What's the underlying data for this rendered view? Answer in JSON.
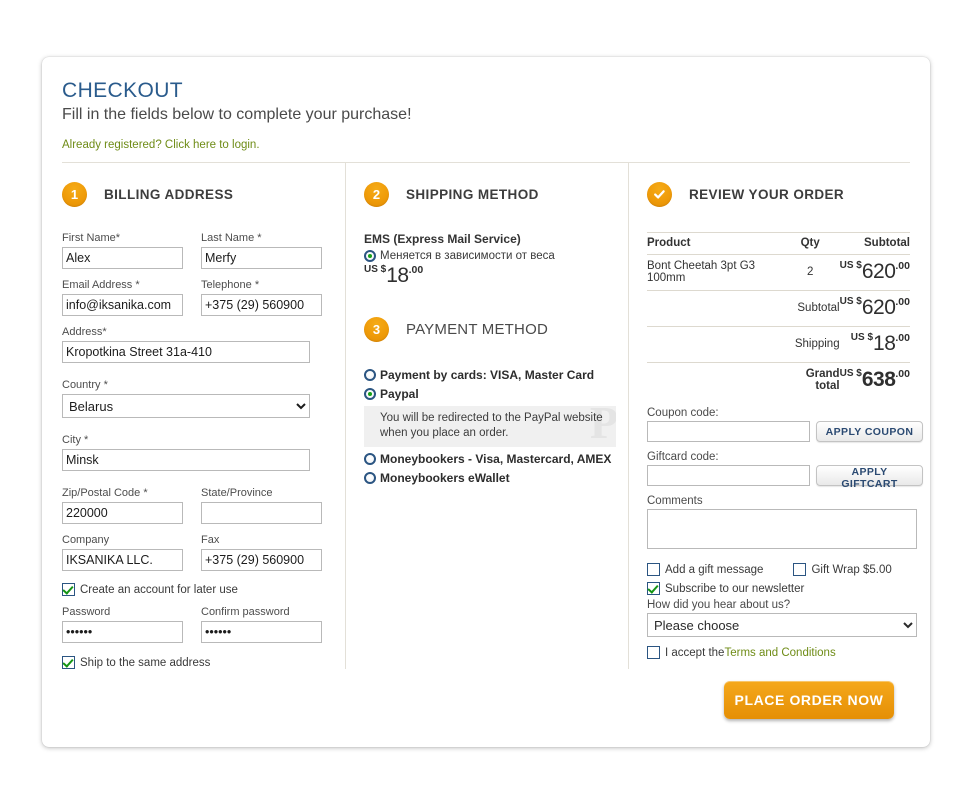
{
  "header": {
    "title": "CHECKOUT",
    "subtitle": "Fill in the fields below to complete your purchase!",
    "login_link": "Already registered? Click here to login."
  },
  "colors": {
    "accent_orange": "#ef9b09",
    "title_blue": "#2a5b8c",
    "link_green": "#6f8c17",
    "button_blue_text": "#2b4a72"
  },
  "billing": {
    "step_number": "1",
    "step_title": "BILLING ADDRESS",
    "fields": {
      "first_name_label": "First Name*",
      "first_name_value": "Alex",
      "last_name_label": "Last Name *",
      "last_name_value": "Merfy",
      "email_label": "Email Address *",
      "email_value": "info@iksanika.com",
      "telephone_label": "Telephone *",
      "telephone_value": "+375 (29) 560900",
      "address_label": "Address*",
      "address_value": "Kropotkina Street 31a-410",
      "country_label": "Country *",
      "country_value": "Belarus",
      "city_label": "City *",
      "city_value": "Minsk",
      "zip_label": "Zip/Postal Code *",
      "zip_value": "220000",
      "state_label": "State/Province",
      "state_value": "",
      "company_label": "Company",
      "company_value": "IKSANIKA LLC.",
      "fax_label": "Fax",
      "fax_value": "+375 (29) 560900",
      "password_label": "Password",
      "password_value": "······",
      "confirm_password_label": "Confirm password",
      "confirm_password_value": "······"
    },
    "create_account_label": "Create an account for later use",
    "create_account_checked": true,
    "ship_same_label": "Ship to the same address",
    "ship_same_checked": true
  },
  "shipping": {
    "step_number": "2",
    "step_title": "SHIPPING METHOD",
    "carrier": "EMS (Express Mail Service)",
    "option_label": "Меняется в зависимости от веса",
    "option_selected": true,
    "price_currency": "US $",
    "price_int": "18",
    "price_dec": ".00"
  },
  "payment": {
    "step_number": "3",
    "step_title": "PAYMENT METHOD",
    "options": [
      {
        "label": "Payment by cards: VISA, Master Card",
        "selected": false
      },
      {
        "label": "Paypal",
        "selected": true
      },
      {
        "label": "Moneybookers - Visa, Mastercard, AMEX",
        "selected": false
      },
      {
        "label": "Moneybookers eWallet",
        "selected": false
      }
    ],
    "paypal_note": "You will be redirected to the PayPal website when you place an order.",
    "paypal_watermark": "P"
  },
  "review": {
    "step_title": "REVIEW YOUR ORDER",
    "badge_icon": "check-icon",
    "table": {
      "headers": {
        "product": "Product",
        "qty": "Qty",
        "subtotal": "Subtotal"
      },
      "rows": [
        {
          "product": "Bont Cheetah 3pt G3 100mm",
          "qty": "2",
          "currency": "US $",
          "int": "620",
          "dec": ".00"
        }
      ],
      "totals": [
        {
          "label": "Subtotal",
          "currency": "US $",
          "int": "620",
          "dec": ".00",
          "bold": false
        },
        {
          "label": "Shipping",
          "currency": "US $",
          "int": "18",
          "dec": ".00",
          "bold": false
        },
        {
          "label": "Grand total",
          "currency": "US $",
          "int": "638",
          "dec": ".00",
          "bold": true
        }
      ]
    },
    "coupon_label": "Coupon code:",
    "coupon_value": "",
    "coupon_button": "APPLY COUPON",
    "giftcard_label": "Giftcard code:",
    "giftcard_value": "",
    "giftcard_button": "APPLY GIFTCART",
    "comments_label": "Comments",
    "comments_value": "",
    "gift_message_label": "Add a gift message",
    "gift_message_checked": false,
    "gift_wrap_label": "Gift Wrap $5.00",
    "gift_wrap_checked": false,
    "newsletter_label": "Subscribe to our newsletter",
    "newsletter_checked": true,
    "hear_about_label": "How did you hear about us?",
    "hear_about_value": "Please choose",
    "terms_prefix": "I accept the ",
    "terms_link": "Terms and Conditions",
    "terms_checked": false,
    "place_order_button": "PLACE ORDER NOW"
  }
}
